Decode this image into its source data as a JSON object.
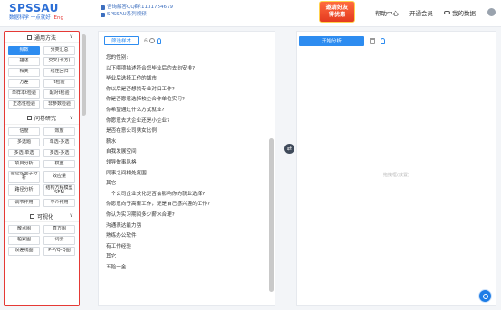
{
  "header": {
    "logo": "SPSSAU",
    "slogan": "数据科学 一点就好",
    "lang": "Eng",
    "contact_line1": "咨询解答QQ群:1131754679",
    "contact_line2": "SPSSAU系列视频",
    "invite_line1": "邀请好友",
    "invite_line2": "得优惠",
    "nav": {
      "help": "帮助中心",
      "vip": "开通会员",
      "mydata": "我的数据"
    }
  },
  "sidebar": {
    "sections": [
      {
        "title": "通用方法",
        "items": [
          "频数",
          "分类汇总",
          "描述",
          "交叉(卡方)",
          "相关",
          "线性回归",
          "方差",
          "t检验",
          "单样本t检验",
          "配对t检验",
          "正态性检验",
          "非参数检验"
        ],
        "active": 0
      },
      {
        "title": "问卷研究",
        "items": [
          "信度",
          "效度",
          "多选题",
          "单选-多选",
          "多选-单选",
          "多选-多选",
          "项目分析",
          "权重",
          "验证性因子分析",
          "效应量",
          "路径分析",
          "结构方程模型SEM",
          "调节作用",
          "中介作用"
        ]
      },
      {
        "title": "可视化",
        "items": [
          "散点图",
          "直方图",
          "帕累图",
          "词云",
          "误差线图",
          "P-P/Q-Q图"
        ]
      }
    ]
  },
  "middle": {
    "select_button": "筛选样本",
    "count": "6",
    "variables": [
      "您的性别:",
      "以下哪项描述符合您毕业后的去向安排?",
      "毕业后选择工作的城市",
      "你以后是否想找专业对口工作?",
      "你是否愿意选择校企合作单位实习?",
      "你希望通过什么方式就业?",
      "你愿意去大企业还是小企业?",
      "是否在意公司男女比例",
      "薪水",
      "自我发展空间",
      "领导做事风格",
      "同事之间相处氛围",
      "其它",
      "一个公司企业文化是否会影响你的就业选择?",
      "你愿意向于高薪工作，还是自己感兴趣的工作?",
      "你认为实习期间多少薪水合理?",
      "沟通表达能力强",
      "熟练办公软件",
      "有工作经验",
      "其它",
      "五险一金"
    ]
  },
  "right": {
    "analyze_button": "开始分析",
    "placeholder": "拖拽框(放置)"
  }
}
